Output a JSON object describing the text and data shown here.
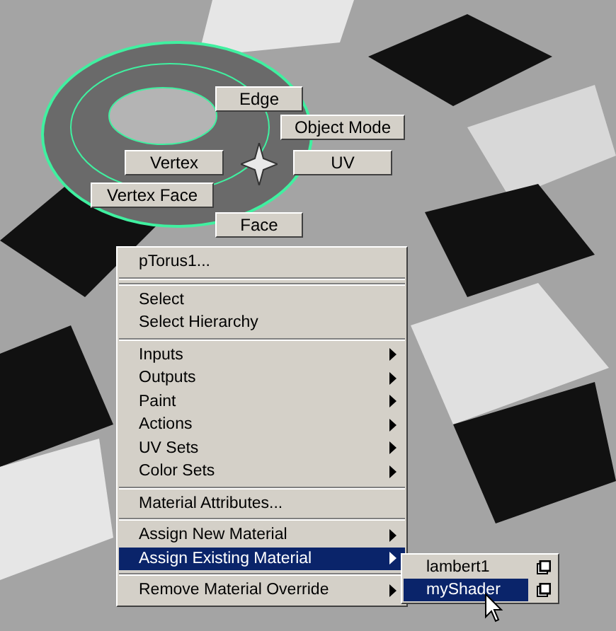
{
  "marking_menu": [
    {
      "label": "Edge"
    },
    {
      "label": "Object Mode"
    },
    {
      "label": "Vertex"
    },
    {
      "label": "UV"
    },
    {
      "label": "Vertex Face"
    },
    {
      "label": "Face"
    }
  ],
  "context_menu": [
    {
      "kind": "item",
      "label": "pTorus1...",
      "selected": false
    },
    {
      "kind": "double_separator"
    },
    {
      "kind": "item",
      "label": "Select",
      "selected": false
    },
    {
      "kind": "item",
      "label": "Select Hierarchy",
      "selected": false
    },
    {
      "kind": "separator"
    },
    {
      "kind": "submenu",
      "label": "Inputs",
      "selected": false
    },
    {
      "kind": "submenu",
      "label": "Outputs",
      "selected": false
    },
    {
      "kind": "submenu",
      "label": "Paint",
      "selected": false
    },
    {
      "kind": "submenu",
      "label": "Actions",
      "selected": false
    },
    {
      "kind": "submenu",
      "label": "UV Sets",
      "selected": false
    },
    {
      "kind": "submenu",
      "label": "Color Sets",
      "selected": false
    },
    {
      "kind": "separator"
    },
    {
      "kind": "item",
      "label": "Material Attributes...",
      "selected": false
    },
    {
      "kind": "separator"
    },
    {
      "kind": "submenu",
      "label": "Assign New Material",
      "selected": false
    },
    {
      "kind": "submenu",
      "label": "Assign Existing Material",
      "selected": true
    },
    {
      "kind": "separator"
    },
    {
      "kind": "submenu",
      "label": "Remove Material Override",
      "selected": false
    }
  ],
  "submenu": [
    {
      "label": "lambert1",
      "selected": false
    },
    {
      "label": "myShader",
      "selected": true
    }
  ]
}
